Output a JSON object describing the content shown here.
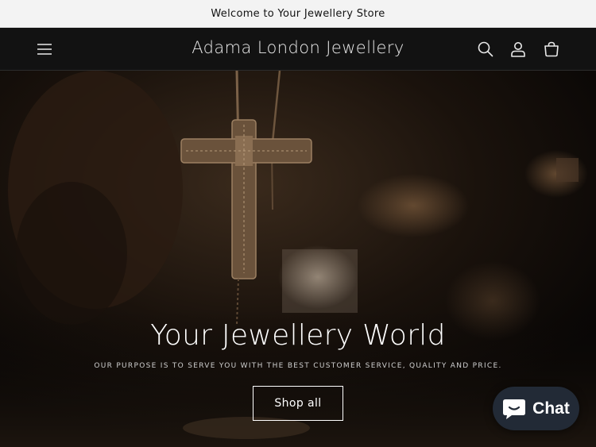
{
  "announcement": {
    "text": "Welcome to Your Jewellery Store"
  },
  "header": {
    "brand": "Adama London Jewellery",
    "icons": [
      "menu-icon",
      "search-icon",
      "account-icon",
      "cart-icon"
    ]
  },
  "hero": {
    "title": "Your Jewellery World",
    "subtitle": "OUR PURPOSE IS TO SERVE YOU WITH THE BEST CUSTOMER SERVICE, QUALITY AND PRICE.",
    "button_label": "Shop all"
  },
  "chat": {
    "label": "Chat",
    "icon": "chat-bubble-icon"
  },
  "colors": {
    "announcement_bg": "#f3f3f3",
    "header_bg": "#121212",
    "chat_bg": "#222a36",
    "text_light": "#ffffff"
  }
}
